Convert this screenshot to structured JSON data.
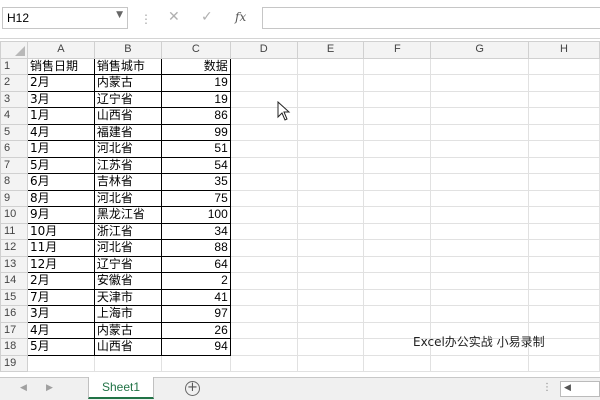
{
  "formula_bar": {
    "name_box": "H12",
    "cancel_icon": "✕",
    "enter_icon": "✓",
    "fx_label": "fx",
    "formula_value": ""
  },
  "columns": [
    "A",
    "B",
    "C",
    "D",
    "E",
    "F",
    "G",
    "H"
  ],
  "rows": [
    {
      "n": "1",
      "a": "销售日期",
      "b": "销售城市",
      "c": "数据"
    },
    {
      "n": "2",
      "a": "2月",
      "b": "内蒙古",
      "c": "19"
    },
    {
      "n": "3",
      "a": "3月",
      "b": "辽宁省",
      "c": "19"
    },
    {
      "n": "4",
      "a": "1月",
      "b": "山西省",
      "c": "86"
    },
    {
      "n": "5",
      "a": "4月",
      "b": "福建省",
      "c": "99"
    },
    {
      "n": "6",
      "a": "1月",
      "b": "河北省",
      "c": "51"
    },
    {
      "n": "7",
      "a": "5月",
      "b": "江苏省",
      "c": "54"
    },
    {
      "n": "8",
      "a": "6月",
      "b": "吉林省",
      "c": "35"
    },
    {
      "n": "9",
      "a": "8月",
      "b": "河北省",
      "c": "75"
    },
    {
      "n": "10",
      "a": "9月",
      "b": "黑龙江省",
      "c": "100"
    },
    {
      "n": "11",
      "a": "10月",
      "b": "浙江省",
      "c": "34"
    },
    {
      "n": "12",
      "a": "11月",
      "b": "河北省",
      "c": "88"
    },
    {
      "n": "13",
      "a": "12月",
      "b": "辽宁省",
      "c": "64"
    },
    {
      "n": "14",
      "a": "2月",
      "b": "安徽省",
      "c": "2"
    },
    {
      "n": "15",
      "a": "7月",
      "b": "天津市",
      "c": "41"
    },
    {
      "n": "16",
      "a": "3月",
      "b": "上海市",
      "c": "97"
    },
    {
      "n": "17",
      "a": "4月",
      "b": "内蒙古",
      "c": "26"
    },
    {
      "n": "18",
      "a": "5月",
      "b": "山西省",
      "c": "94"
    },
    {
      "n": "19",
      "a": "",
      "b": "",
      "c": ""
    }
  ],
  "watermark": "Excel办公实战 小易录制",
  "sheet_tabs": {
    "active": "Sheet1",
    "add_icon": "+",
    "more_icon": "⋮"
  },
  "colors": {
    "accent": "#217346",
    "header_bg": "#f3f3f3",
    "grid_line": "#e1e1e1"
  }
}
